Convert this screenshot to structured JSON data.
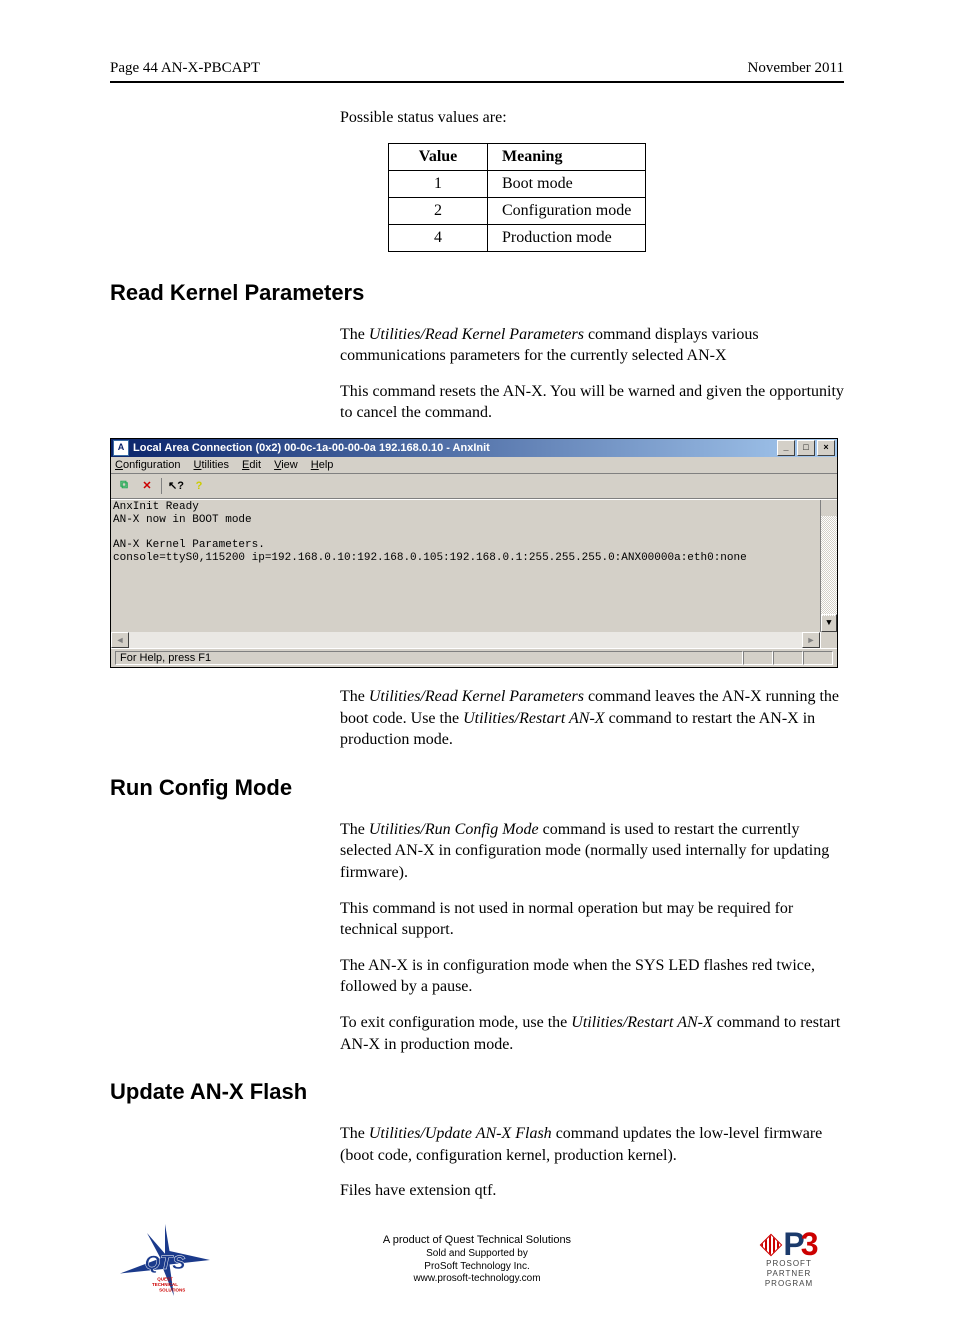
{
  "header": {
    "left": "Page  44  AN-X-PBCAPT",
    "right": "November 2011"
  },
  "intro_line": "Possible status values are:",
  "status_table": {
    "headers": {
      "value": "Value",
      "meaning": "Meaning"
    },
    "rows": [
      {
        "value": "1",
        "meaning": "Boot mode"
      },
      {
        "value": "2",
        "meaning": "Configuration mode"
      },
      {
        "value": "4",
        "meaning": "Production mode"
      }
    ]
  },
  "sections": {
    "read_kernel": {
      "title": "Read Kernel Parameters",
      "p1_pre": "The ",
      "p1_em": "Utilities/Read Kernel Parameters",
      "p1_post": " command displays various communications parameters for the currently selected AN-X",
      "p2": "This command resets the AN-X.  You will be warned and given the opportunity to cancel the command.",
      "after_pre": "The ",
      "after_em1": "Utilities/Read Kernel Parameters",
      "after_mid": " command leaves the AN-X running the boot code.  Use the ",
      "after_em2": "Utilities/Restart AN-X",
      "after_post": " command to restart the AN-X in production mode."
    },
    "run_config": {
      "title": "Run Config Mode",
      "p1_pre": "The ",
      "p1_em": "Utilities/Run Config Mode",
      "p1_post": " command is used to restart the currently selected AN-X  in configuration mode (normally used internally for updating firmware).",
      "p2": "This command is not used in normal operation but may be required for technical support.",
      "p3": "The AN-X is in configuration mode when the SYS LED  flashes red twice, followed by a pause.",
      "p4_pre": "To exit configuration mode, use the ",
      "p4_em": "Utilities/Restart AN-X",
      "p4_post": " command to restart AN-X in production mode."
    },
    "update_flash": {
      "title": "Update AN-X Flash",
      "p1_pre": "The ",
      "p1_em": "Utilities/Update AN-X Flash",
      "p1_post": " command updates the low-level firmware (boot code, configuration kernel, production kernel).",
      "p2": "Files have extension qtf."
    }
  },
  "window": {
    "title": "Local Area Connection (0x2) 00-0c-1a-00-00-0a  192.168.0.10 - AnxInit",
    "menus": {
      "configuration": "Configuration",
      "utilities": "Utilities",
      "edit": "Edit",
      "view": "View",
      "help": "Help"
    },
    "toolbar_icons": {
      "copy": "copy-icon",
      "delete": "delete-icon",
      "context_help": "context-help-icon",
      "about": "about-icon"
    },
    "console_text": "AnxInit Ready\nAN-X now in BOOT mode\n\nAN-X Kernel Parameters.\nconsole=ttyS0,115200 ip=192.168.0.10:192.168.0.105:192.168.0.1:255.255.255.0:ANX00000a:eth0:none\n",
    "statusbar": "For Help, press F1"
  },
  "footer": {
    "line1": "A product of Quest Technical Solutions",
    "line2": "Sold and Supported by",
    "line3": "ProSoft Technology Inc.",
    "line4": "www.prosoft-technology.com",
    "qts_label": "QTS",
    "qts_sub": "Quest Technical Solutions",
    "p3_prosoft": "PROSOFT",
    "p3_partner": "PARTNER",
    "p3_program": "PROGRAM"
  }
}
